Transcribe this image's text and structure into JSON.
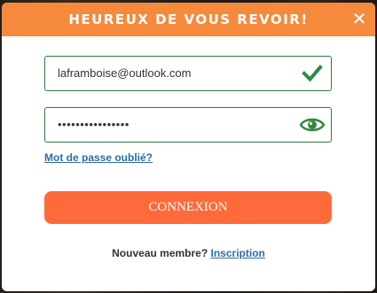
{
  "modal": {
    "title": "HEUREUX DE VOUS REVOIR!",
    "close_icon": "close-icon"
  },
  "email_field": {
    "value": "laframboise@outlook.com",
    "status_icon": "checkmark-icon",
    "status_color": "#2f8a3f"
  },
  "password_field": {
    "value": "••••••••••••••••",
    "toggle_icon": "eye-icon",
    "icon_color": "#2f8a3f"
  },
  "forgot_password": {
    "label": "Mot de passe oublié?"
  },
  "login_button": {
    "label": "CONNEXION",
    "color": "#ff6a3a"
  },
  "signup": {
    "prompt": "Nouveau membre?",
    "link_label": "Inscription"
  },
  "colors": {
    "header": "#f58a3c",
    "link": "#2e6da4",
    "field_border": "#2f7a3d"
  }
}
